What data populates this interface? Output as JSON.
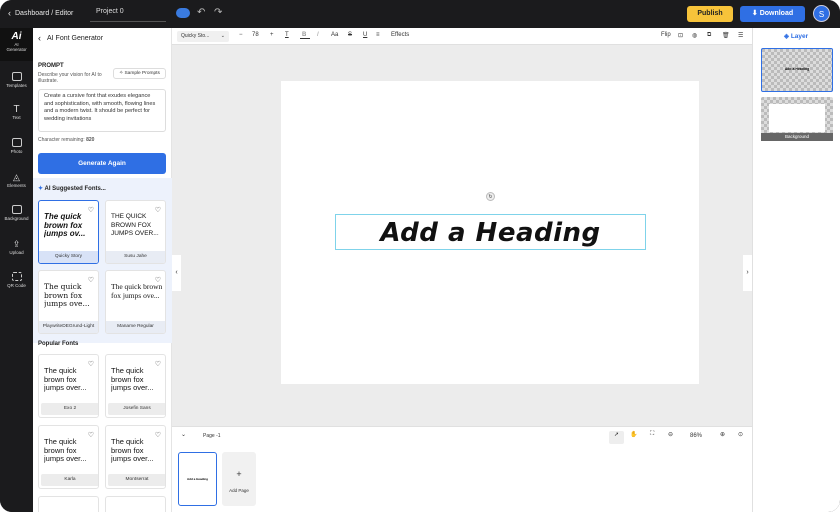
{
  "topbar": {
    "breadcrumb": "Dashboard / Editor",
    "project_name": "Project 0",
    "publish_label": "Publish",
    "download_label": "Download",
    "avatar_initial": "S"
  },
  "rail": {
    "items": [
      {
        "label": "AI Generator",
        "icon": "ai-icon"
      },
      {
        "label": "Templates",
        "icon": "templates-icon"
      },
      {
        "label": "Text",
        "icon": "text-icon"
      },
      {
        "label": "Photo",
        "icon": "photo-icon"
      },
      {
        "label": "Elements",
        "icon": "elements-icon"
      },
      {
        "label": "Background",
        "icon": "background-icon"
      },
      {
        "label": "Upload",
        "icon": "upload-icon"
      },
      {
        "label": "QR Code",
        "icon": "qr-code-icon"
      }
    ]
  },
  "panel": {
    "title": "AI Font Generator",
    "prompt_heading": "PROMPT",
    "prompt_description": "Describe your vision for AI to illustrate.",
    "sample_prompts_label": "Sample Prompts",
    "prompt_text": "Create a cursive font that exudes elegance and sophistication, with smooth, flowing lines and a modern twist. It should be perfect for wedding invitations",
    "chars_label": "Character remaining:",
    "chars_value": "820",
    "generate_label": "Generate Again",
    "suggested_heading": "AI Suggested Fonts...",
    "suggested": [
      {
        "sample": "The quick brown fox jumps ov...",
        "name": "Quicky Story"
      },
      {
        "sample": "THE QUICK BROWN FOX JUMPS OVER...",
        "name": "Susu Jahe"
      },
      {
        "sample": "The quick brown fox jumps ove...",
        "name": "PlaywriteDEGrund-Light"
      },
      {
        "sample": "The quick brown fox jumps ove...",
        "name": "Maname Regular"
      }
    ],
    "popular_heading": "Popular Fonts",
    "popular": [
      {
        "sample": "The quick brown fox jumps over...",
        "name": "Exo 2"
      },
      {
        "sample": "The quick brown fox jumps over...",
        "name": "Josefin Sans"
      },
      {
        "sample": "The quick brown fox jumps over...",
        "name": "Karla"
      },
      {
        "sample": "The quick brown fox jumps over...",
        "name": "Montserrat"
      }
    ]
  },
  "toolbar": {
    "font_name": "Quicky Sto...",
    "minus": "−",
    "font_size": "78",
    "plus": "+",
    "effects_label": "Effects",
    "flip_label": "Flip"
  },
  "canvas": {
    "heading_text": "Add a Heading"
  },
  "pagebar": {
    "page_label": "Page -1",
    "zoom": "86%"
  },
  "thumbs": {
    "add_page_label": "Add Page"
  },
  "layer": {
    "title": "Layer",
    "background_label": "Background"
  },
  "colors": {
    "accent": "#2f6fe4",
    "publish": "#f7c33a",
    "dark": "#1b1b1d"
  }
}
